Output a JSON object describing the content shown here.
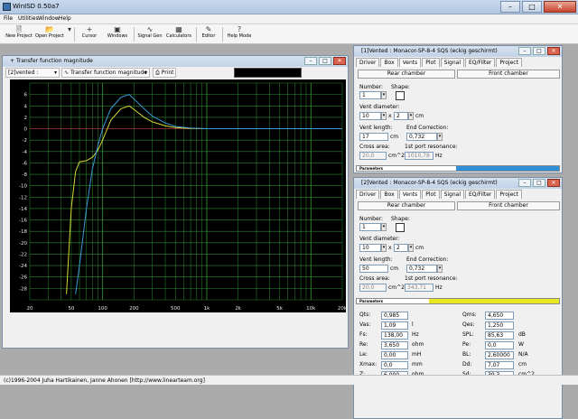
{
  "app": {
    "title": "WinISD 0.50a7"
  },
  "menu": [
    "File",
    "Utilities",
    "Window",
    "Help"
  ],
  "toolbar": [
    {
      "label": "New Project",
      "icon": "new-project-icon"
    },
    {
      "label": "Open Project",
      "icon": "open-project-icon"
    },
    {
      "label": "Cursor",
      "icon": "cursor-icon"
    },
    {
      "label": "Windows",
      "icon": "windows-icon"
    },
    {
      "label": "Signal Gen",
      "icon": "signal-gen-icon"
    },
    {
      "label": "Calculators",
      "icon": "calculators-icon"
    },
    {
      "label": "Editor",
      "icon": "editor-icon"
    },
    {
      "label": "Help Mode",
      "icon": "help-mode-icon"
    }
  ],
  "graph_window": {
    "title": "Transfer function magnitude",
    "project_select": "[2]vented :",
    "graph_select": "Transfer function magnitude",
    "print_label": "Print"
  },
  "chart_data": {
    "type": "line",
    "xscale": "log",
    "xlim": [
      20,
      20000
    ],
    "ylim": [
      -30,
      8
    ],
    "x_ticks": [
      "20",
      "50",
      "100",
      "200",
      "500",
      "1k",
      "2k",
      "5k",
      "10k",
      "20k"
    ],
    "y_ticks": [
      "6",
      "4",
      "2",
      "0",
      "-2",
      "-4",
      "-6",
      "-8",
      "-10",
      "-12",
      "-14",
      "-16",
      "-18",
      "-20",
      "-22",
      "-24",
      "-26",
      "-28"
    ],
    "colors": {
      "background": "#000000",
      "grid": "#2f8a2f",
      "zero_line": "#c04040",
      "project1": "#d8d838",
      "project2": "#3a9ad8"
    },
    "series": [
      {
        "x": [
          45,
          50,
          55,
          60,
          70,
          80,
          90,
          100,
          120,
          150,
          180,
          200,
          250,
          300,
          400,
          500,
          700,
          1000,
          2000,
          20000
        ],
        "y": [
          -29,
          -14,
          -7.5,
          -5.8,
          -5.6,
          -5,
          -3.8,
          -2,
          1.5,
          3.5,
          4,
          3.4,
          2,
          1.2,
          0.5,
          0.2,
          0.05,
          0,
          0,
          0
        ]
      },
      {
        "x": [
          55,
          60,
          70,
          80,
          90,
          100,
          120,
          150,
          180,
          200,
          250,
          300,
          400,
          500,
          700,
          1000,
          2000,
          20000
        ],
        "y": [
          -29,
          -24,
          -14,
          -7,
          -3,
          0,
          3.5,
          5.5,
          6,
          5.2,
          3.5,
          2.2,
          1,
          0.4,
          0.1,
          0,
          0,
          0
        ]
      }
    ]
  },
  "vent_windows": [
    {
      "title": "[1]Vented : Monacor-SP-8-4 SQS (eckig geschirmt)",
      "tabs": [
        "Driver",
        "Box",
        "Vents",
        "Plot",
        "Signal",
        "EQ/Filter",
        "Project"
      ],
      "active_tab": "Vents",
      "rear_chamber": "Rear chamber",
      "front_chamber": "Front chamber",
      "number_label": "Number:",
      "number_value": "1",
      "shape_label": "Shape:",
      "diameter_label": "Vent diameter:",
      "diameter_value": "10",
      "times": "x",
      "diameter_count": "2",
      "diameter_unit": "cm",
      "length_label": "Vent length:",
      "length_value": "17",
      "length_unit": "cm",
      "end_correction_label": "End Correction:",
      "end_correction_value": "0,732",
      "cross_area_label": "Cross area:",
      "cross_area_value": "20,0",
      "cross_area_unit": "cm^2",
      "resonance_label": "1st port resonance:",
      "resonance_value": "1010,78",
      "resonance_unit": "Hz",
      "params_label": "Parameters",
      "progress_color": "#2f8fd8"
    },
    {
      "title": "[2]Vented : Monacor-SP-8-4 SQS (eckig geschirmt)",
      "tabs": [
        "Driver",
        "Box",
        "Vents",
        "Plot",
        "Signal",
        "EQ/Filter",
        "Project"
      ],
      "active_tab": "Vents",
      "rear_chamber": "Rear chamber",
      "front_chamber": "Front chamber",
      "number_label": "Number:",
      "number_value": "1",
      "shape_label": "Shape:",
      "diameter_label": "Vent diameter:",
      "diameter_value": "10",
      "times": "x",
      "diameter_count": "2",
      "diameter_unit": "cm",
      "length_label": "Vent length:",
      "length_value": "50",
      "length_unit": "cm",
      "end_correction_label": "End Correction:",
      "end_correction_value": "0,732",
      "cross_area_label": "Cross area:",
      "cross_area_value": "20,0",
      "cross_area_unit": "cm^2",
      "resonance_label": "1st port resonance:",
      "resonance_value": "343,71",
      "resonance_unit": "Hz",
      "params_label": "Parameters",
      "progress_color": "#e8e820",
      "driver_params": [
        {
          "name": "Qts:",
          "value": "0,985",
          "unit": "",
          "name2": "Qms:",
          "value2": "4,650",
          "unit2": ""
        },
        {
          "name": "Vas:",
          "value": "1,09",
          "unit": "l",
          "name2": "Qes:",
          "value2": "1,250",
          "unit2": ""
        },
        {
          "name": "Fs:",
          "value": "138,00",
          "unit": "Hz",
          "name2": "SPL:",
          "value2": "85,63",
          "unit2": "dB"
        },
        {
          "name": "Re:",
          "value": "3,650",
          "unit": "ohm",
          "name2": "Pe:",
          "value2": "0,0",
          "unit2": "W"
        },
        {
          "name": "Le:",
          "value": "0,00",
          "unit": "mH",
          "name2": "BL:",
          "value2": "2,60000",
          "unit2": "N/A"
        },
        {
          "name": "Xmax:",
          "value": "0,0",
          "unit": "mm",
          "name2": "Dd:",
          "value2": "7,07",
          "unit2": "cm"
        },
        {
          "name": "Z:",
          "value": "6,000",
          "unit": "ohm",
          "name2": "Sd:",
          "value2": "39,3",
          "unit2": "cm^2"
        }
      ]
    }
  ],
  "status": {
    "text": "(c)1996-2004 Juha Hartikainen, Janne Ahonen [http://www.linearteam.org]"
  }
}
